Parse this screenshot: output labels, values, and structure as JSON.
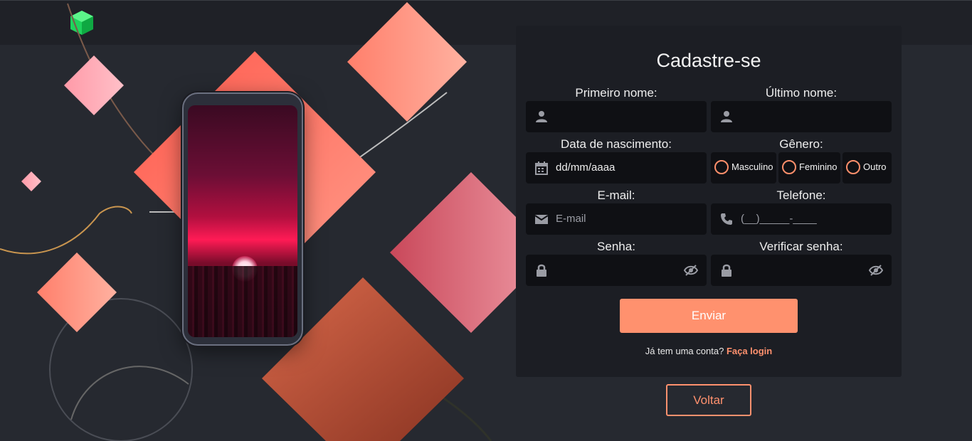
{
  "form": {
    "title": "Cadastre-se",
    "first_name_label": "Primeiro nome:",
    "last_name_label": "Último nome:",
    "birth_label": "Data de nascimento:",
    "birth_value": "dd/mm/aaaa",
    "gender_label": "Gênero:",
    "gender_options": [
      "Masculino",
      "Feminino",
      "Outro"
    ],
    "email_label": "E-mail:",
    "email_placeholder": "E-mail",
    "phone_label": "Telefone:",
    "phone_placeholder": "(__)_____-____",
    "password_label": "Senha:",
    "confirm_label": "Verificar senha:",
    "submit_label": "Enviar",
    "login_prompt": "Já tem uma conta?",
    "login_link": "Faça login"
  },
  "back_label": "Voltar",
  "icons": {
    "first_name": "user-icon",
    "last_name": "user-icon",
    "birth": "calendar-icon",
    "email": "envelope-icon",
    "phone": "phone-icon",
    "password": "lock-icon",
    "toggle": "eye-slash-icon"
  },
  "colors": {
    "accent": "#ff916e",
    "background": "#262930",
    "panel": "#1c1e24",
    "field": "#0f1014"
  }
}
